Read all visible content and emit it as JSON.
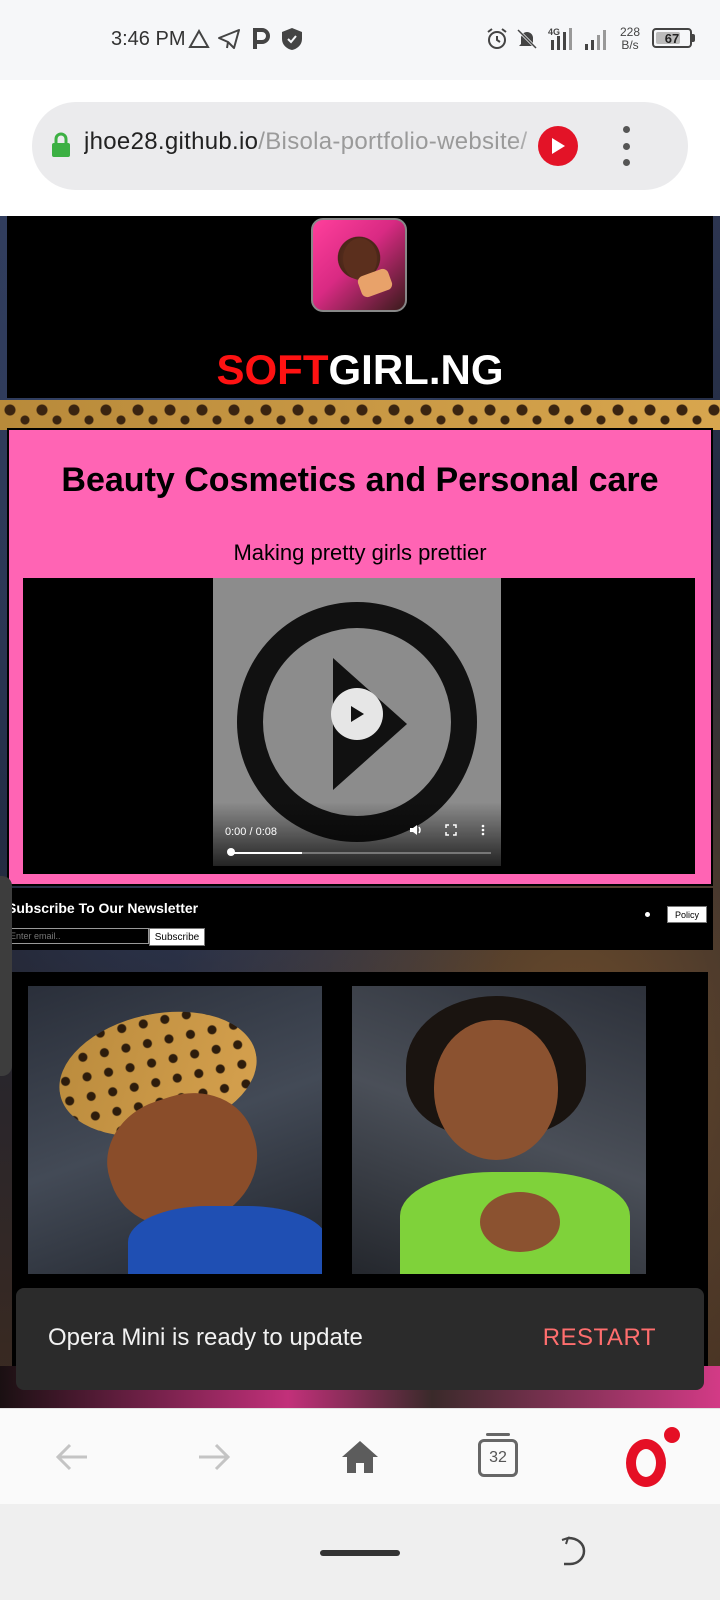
{
  "status_bar": {
    "time": "3:46 PM",
    "net_speed_value": "228",
    "net_speed_unit": "B/s",
    "battery_level": "67",
    "icons": [
      "drive-icon",
      "telegram-icon",
      "parking-icon",
      "shield-icon",
      "alarm-icon",
      "mute-icon",
      "4g-signal-icon",
      "signal-icon",
      "battery-icon"
    ]
  },
  "browser": {
    "url_domain": "jhoe28.github.io",
    "url_path": "/Bisola-portfolio-website/",
    "accent": "#e31327"
  },
  "site": {
    "brand_part1": "SOFT",
    "brand_part2": "GIRL.NG",
    "brand_color_accent": "#ff1212",
    "hero_title": "Beauty Cosmetics and Personal care",
    "hero_subtitle": "Making pretty girls prettier",
    "hero_bg": "#ff64b4",
    "video_time": "0:00 / 0:08",
    "video_progress": 0.28,
    "newsletter_title": "Subscribe To Our Newsletter",
    "newsletter_placeholder": "Enter email..",
    "newsletter_button": "Subscribe",
    "policy_button": "Policy"
  },
  "toast": {
    "message": "Opera Mini is ready to update",
    "action": "RESTART"
  },
  "bottom_nav": {
    "tabs_count": "32"
  }
}
